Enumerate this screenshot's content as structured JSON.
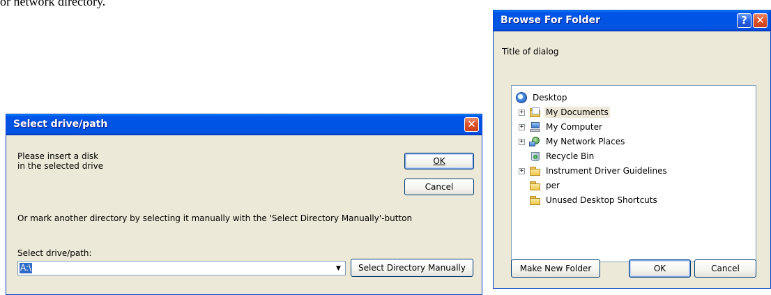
{
  "background_text": "or network directory.",
  "select_dialog": {
    "title": "Select drive/path",
    "message_line1": "Please insert a disk",
    "message_line2": "in the selected drive",
    "ok_label": "OK",
    "cancel_label": "Cancel",
    "instruction": "Or mark another directory by selecting it manually with the 'Select Directory Manually'-button",
    "path_label": "Select drive/path:",
    "path_value": "A:\\",
    "manual_button_label": "Select Directory Manually",
    "close_glyph": "✕"
  },
  "browse_dialog": {
    "title": "Browse For Folder",
    "subtitle": "Title of dialog",
    "help_glyph": "?",
    "close_glyph": "✕",
    "tree": [
      {
        "label": "Desktop",
        "icon": "desktop-icon",
        "expandable": false,
        "level": 0
      },
      {
        "label": "My Documents",
        "icon": "my-documents-icon",
        "expandable": true,
        "level": 1,
        "selected": true
      },
      {
        "label": "My Computer",
        "icon": "my-computer-icon",
        "expandable": true,
        "level": 1
      },
      {
        "label": "My Network Places",
        "icon": "network-places-icon",
        "expandable": true,
        "level": 1
      },
      {
        "label": "Recycle Bin",
        "icon": "recycle-bin-icon",
        "expandable": false,
        "level": 1
      },
      {
        "label": "Instrument Driver Guidelines",
        "icon": "folder-icon",
        "expandable": true,
        "level": 1
      },
      {
        "label": "per",
        "icon": "folder-icon",
        "expandable": false,
        "level": 1
      },
      {
        "label": "Unused Desktop Shortcuts",
        "icon": "folder-icon",
        "expandable": false,
        "level": 1
      }
    ],
    "expand_glyph": "+",
    "make_folder_label": "Make New Folder",
    "ok_label": "OK",
    "cancel_label": "Cancel"
  }
}
